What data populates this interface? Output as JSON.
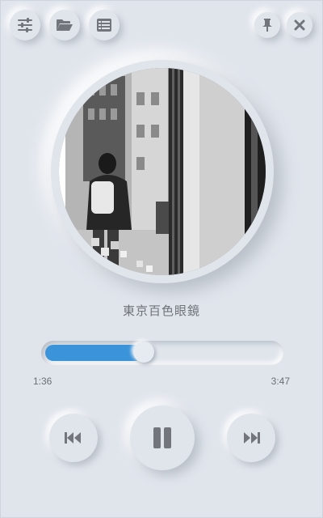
{
  "toolbar": {
    "buttons": [
      {
        "name": "settings-button",
        "icon": "sliders-icon"
      },
      {
        "name": "open-folder-button",
        "icon": "folder-open-icon"
      },
      {
        "name": "playlist-button",
        "icon": "list-icon"
      },
      {
        "name": "pin-button",
        "icon": "pin-icon"
      },
      {
        "name": "close-button",
        "icon": "close-icon"
      }
    ]
  },
  "track": {
    "title": "東京百色眼鏡",
    "current_time": "1:36",
    "total_time": "3:47",
    "progress": 0.42
  },
  "controls": {
    "previous_icon": "skip-back-icon",
    "pause_icon": "pause-icon",
    "next_icon": "skip-forward-icon"
  },
  "colors": {
    "background": "#e0e5ec",
    "accent": "#3b93d9",
    "icon": "#72767c"
  }
}
